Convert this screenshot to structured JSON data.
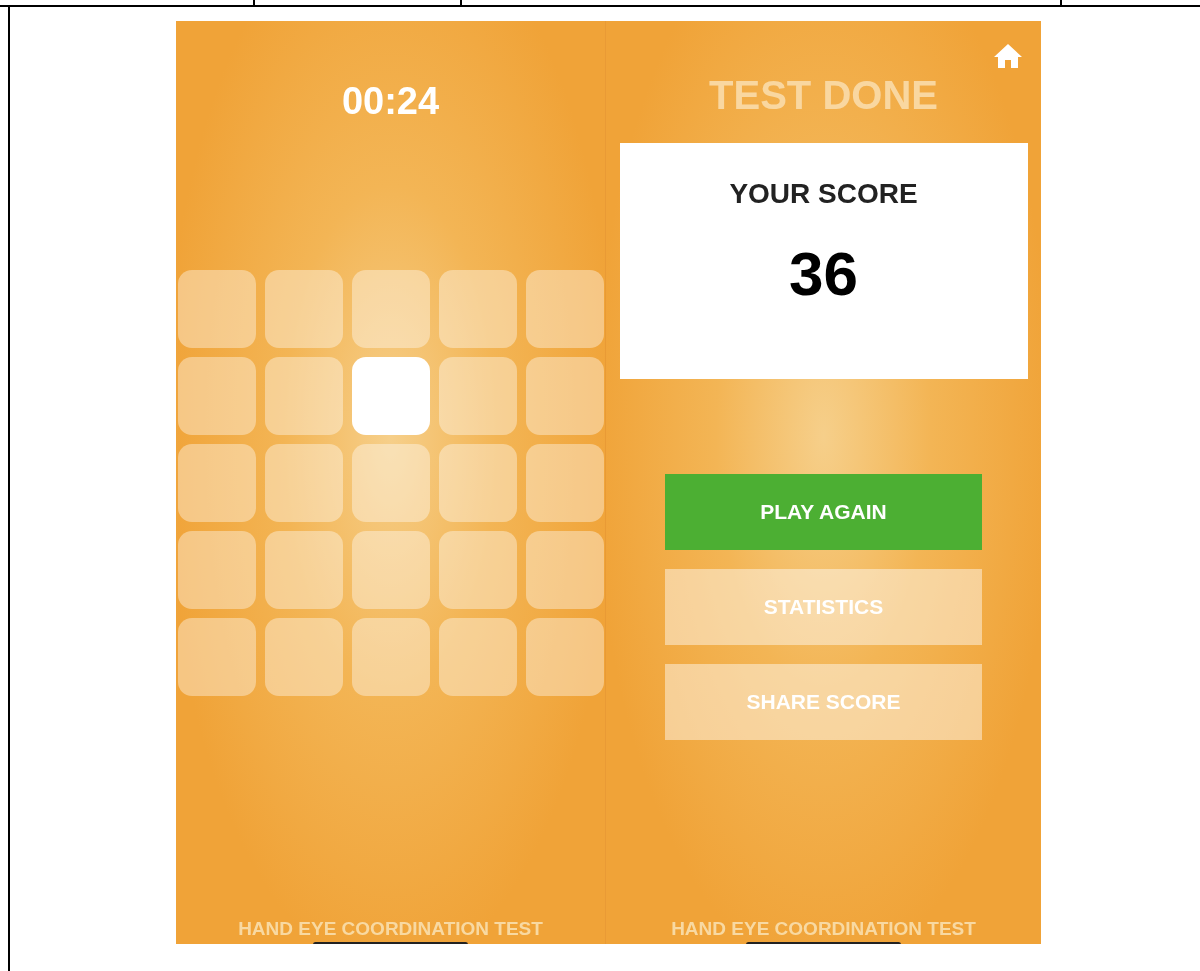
{
  "left_screen": {
    "timer": "00:24",
    "tiles": [
      {
        "lit": false
      },
      {
        "lit": false
      },
      {
        "lit": false
      },
      {
        "lit": false
      },
      {
        "lit": false
      },
      {
        "lit": false
      },
      {
        "lit": false
      },
      {
        "lit": true
      },
      {
        "lit": false
      },
      {
        "lit": false
      },
      {
        "lit": false
      },
      {
        "lit": false
      },
      {
        "lit": false
      },
      {
        "lit": false
      },
      {
        "lit": false
      },
      {
        "lit": false
      },
      {
        "lit": false
      },
      {
        "lit": false
      },
      {
        "lit": false
      },
      {
        "lit": false
      },
      {
        "lit": false
      },
      {
        "lit": false
      },
      {
        "lit": false
      },
      {
        "lit": false
      },
      {
        "lit": false
      }
    ],
    "footer": "HAND EYE COORDINATION TEST"
  },
  "right_screen": {
    "title": "TEST DONE",
    "score_card": {
      "label": "YOUR SCORE",
      "score": "36"
    },
    "buttons": [
      {
        "label": "PLAY AGAIN",
        "kind": "primary"
      },
      {
        "label": "STATISTICS",
        "kind": "secondary"
      },
      {
        "label": "SHARE SCORE",
        "kind": "secondary"
      }
    ],
    "footer": "HAND EYE COORDINATION TEST"
  }
}
